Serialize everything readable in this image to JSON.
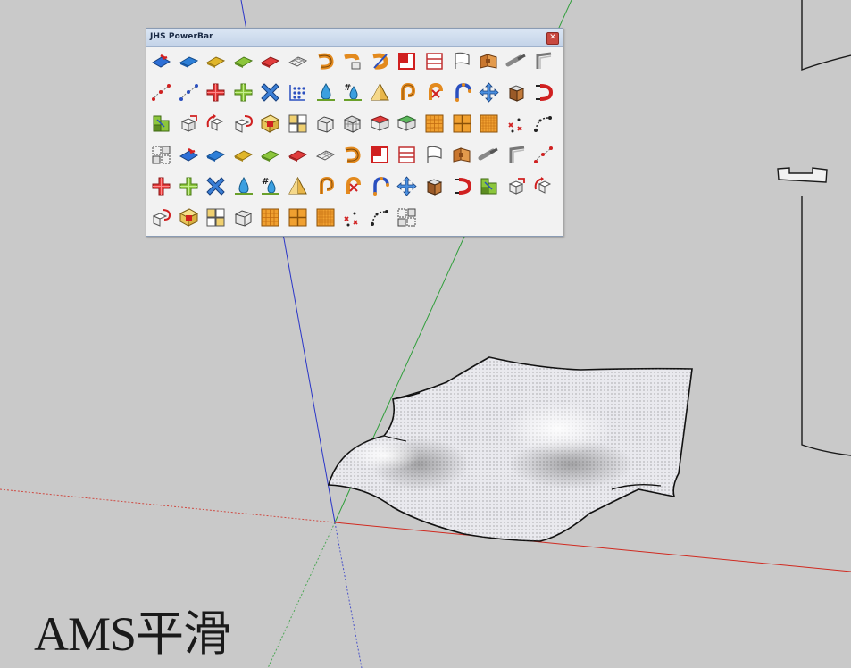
{
  "window": {
    "title": "JHS PowerBar",
    "close_glyph": "✕"
  },
  "caption": "AMS平滑",
  "toolbar_rows": [
    [
      "red-blue-component-icon",
      "blue-plane-icon",
      "yellow-plane-icon",
      "green-plane-icon",
      "red-plane-icon",
      "grid-plane-icon",
      "orange-curve-icon",
      "orange-curve-box-icon",
      "orange-curve-diag-icon",
      "red-square-icon",
      "lined-box-icon",
      "flag-icon",
      "wood-panel-icon",
      "pipe-icon",
      "corner-bracket-icon"
    ],
    [
      "point-chain-icon",
      "point-chain-blue-icon",
      "red-plus-icon",
      "green-plus-icon",
      "blue-cross-icon",
      "dot-grid-icon",
      "water-drop-icon",
      "hash-drop-icon",
      "triangle-icon",
      "orange-loop-icon",
      "orange-loop-x-icon",
      "arc-dots-icon",
      "blue-arrows-icon",
      "wood-box-icon",
      "red-curve-icon"
    ],
    [
      "green-blocks-icon",
      "box-arrow-icon",
      "rotate-box-icon",
      "box-loop-icon",
      "red-dot-square-icon",
      "cube-cluster-icon",
      "wire-box-icon",
      "wire-cube-icon",
      "red-panel-icon",
      "green-panel-icon",
      "orange-grid-icon",
      "orange-quad-icon",
      "orange-grid-fine-icon",
      "red-x-dots-icon",
      "dot-arc-icon"
    ],
    [
      "dashed-grid-icon",
      "red-blue-component-icon",
      "blue-plane-icon",
      "yellow-plane-icon",
      "green-plane-icon",
      "red-plane-icon",
      "grid-plane-icon",
      "orange-curve-icon",
      "red-square-icon",
      "lined-box-icon",
      "flag-icon",
      "wood-panel-icon",
      "pipe-icon",
      "corner-bracket-icon",
      "point-chain-icon"
    ],
    [
      "red-plus-icon",
      "green-plus-icon",
      "blue-cross-icon",
      "water-drop-icon",
      "hash-drop-icon",
      "triangle-icon",
      "orange-loop-icon",
      "orange-loop-x-icon",
      "arc-dots-icon",
      "blue-arrows-icon",
      "wood-box-icon",
      "red-curve-icon",
      "green-blocks-icon",
      "box-arrow-icon",
      "rotate-box-icon"
    ],
    [
      "box-loop-icon",
      "red-dot-square-icon",
      "cube-cluster-icon",
      "wire-box-icon",
      "orange-grid-icon",
      "orange-quad-icon",
      "orange-grid-fine-icon",
      "red-x-dots-icon",
      "dot-arc-icon",
      "dashed-grid-icon"
    ]
  ],
  "colors": {
    "background": "#c9c9c9",
    "red_axis": "#d02a20",
    "green_axis": "#2f9e3a",
    "blue_axis": "#2a35c8"
  }
}
